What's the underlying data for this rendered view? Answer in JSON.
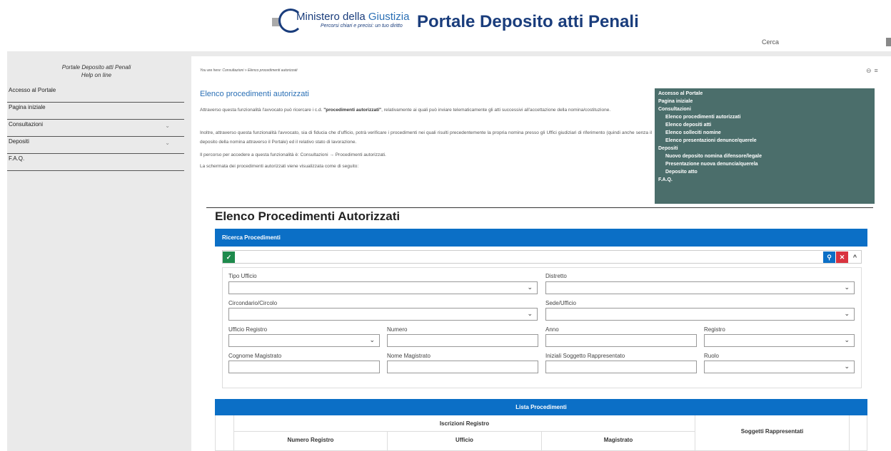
{
  "header": {
    "logo_main": "Ministero della",
    "logo_main_accent": "Giustizia",
    "logo_sub": "Percorsi chiari e precisi: un tuo diritto",
    "title": "Portale Deposito atti Penali",
    "search_label": "Cerca"
  },
  "sidebar": {
    "title_line1": "Portale Deposito atti Penali",
    "title_line2": "Help on line",
    "items": [
      {
        "label": "Accesso al Portale"
      },
      {
        "label": "Pagina iniziale"
      },
      {
        "label": "Consultazioni"
      },
      {
        "label": "Depositi"
      },
      {
        "label": "F.A.Q."
      }
    ]
  },
  "content": {
    "breadcrumb": "You are here: Consultazioni » Elenco procedimenti autorizzati",
    "heading": "Elenco procedimenti autorizzati",
    "p1_a": "Attraverso questa funzionalità l'avvocato può ricercare i c.d. ",
    "p1_b": "\"procedimenti autorizzati\"",
    "p1_c": ", relativamente ai quali può inviare telematicamente gli atti successivi all'accettazione della nomina/costituzione.",
    "p2": "Inoltre, attraverso questa funzionalità l'avvocato, sia di fiducia che d'ufficio, potrà verificare i procedimenti nei quali risulti precedentemente la propria nomina presso gli Uffici giudiziari di riferimento (quindi anche senza il deposito della nomina attraverso il Portale) ed il relativo stato di lavorazione.",
    "p3": "Il percorso per accedere a questa funzionalità è: Consultazioni → Procedimenti autorizzati.",
    "p4": "La schermata dei procedimenti autorizzati viene visualizzata come di seguito:"
  },
  "toc": {
    "items": [
      {
        "label": "Accesso al Portale",
        "level": 0
      },
      {
        "label": "Pagina iniziale",
        "level": 0
      },
      {
        "label": "Consultazioni",
        "level": 0
      },
      {
        "label": "Elenco procedimenti autorizzati",
        "level": 1
      },
      {
        "label": "Elenco depositi atti",
        "level": 1
      },
      {
        "label": "Elenco solleciti nomine",
        "level": 1
      },
      {
        "label": "Elenco presentazioni denunce/querele",
        "level": 1
      },
      {
        "label": "Depositi",
        "level": 0
      },
      {
        "label": "Nuovo deposito nomina difensore/legale",
        "level": 1
      },
      {
        "label": "Presentazione nuova denuncia/querela",
        "level": 1
      },
      {
        "label": "Deposito atto",
        "level": 1
      },
      {
        "label": "F.A.Q.",
        "level": 0
      }
    ]
  },
  "screenshot": {
    "title": "Elenco Procedimenti Autorizzati",
    "panel_title": "Ricerca Procedimenti",
    "fields": {
      "tipo_ufficio": "Tipo Ufficio",
      "distretto": "Distretto",
      "circondario": "Circondario/Circolo",
      "sede": "Sede/Ufficio",
      "ufficio_registro": "Ufficio Registro",
      "numero": "Numero",
      "anno": "Anno",
      "registro": "Registro",
      "cognome": "Cognome Magistrato",
      "nome": "Nome Magistrato",
      "iniziali": "Iniziali Soggetto Rappresentato",
      "ruolo": "Ruolo"
    },
    "list_title": "Lista Procedimenti",
    "table": {
      "group_header": "Iscrizioni Registro",
      "col_numero": "Numero Registro",
      "col_ufficio": "Ufficio",
      "col_magistrato": "Magistrato",
      "col_soggetti": "Soggetti Rappresentati"
    }
  },
  "colors": {
    "brand": "#1a3d7c",
    "panel_blue": "#0b6fc6",
    "toc_bg": "#4b6e6b",
    "btn_green": "#1e8a4c",
    "btn_red": "#d9333f"
  }
}
